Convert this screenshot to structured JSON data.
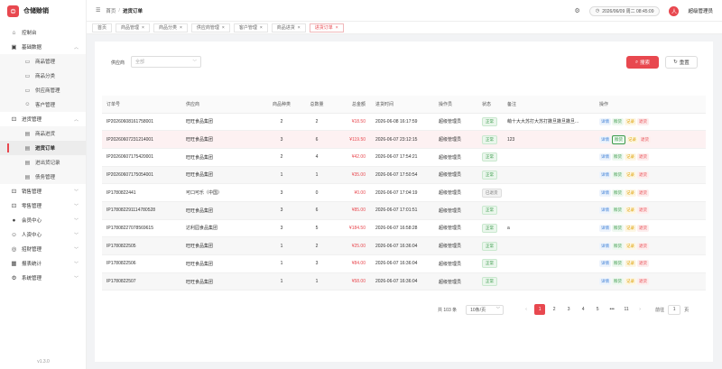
{
  "app": {
    "title": "仓储赊销",
    "logo_glyph": "⊜",
    "version": "v1.3.0",
    "accent": "#e8484f"
  },
  "sidebar": {
    "dashboard": {
      "label": "控制台",
      "icon": "home-icon"
    },
    "basic": {
      "label": "基础数据",
      "icon": "box-icon",
      "children": [
        {
          "label": "商品管理",
          "icon": "folder-icon"
        },
        {
          "label": "商品分类",
          "icon": "folder-icon"
        },
        {
          "label": "供应商管理",
          "icon": "folder-icon"
        },
        {
          "label": "客户管理",
          "icon": "user-icon"
        }
      ]
    },
    "purchase": {
      "label": "进货管理",
      "icon": "cart-icon",
      "children": [
        {
          "label": "商品进货",
          "icon": "doc-icon"
        },
        {
          "label": "进货订单",
          "icon": "doc-icon"
        },
        {
          "label": "进出货记录",
          "icon": "doc-icon"
        },
        {
          "label": "债务管理",
          "icon": "doc-icon"
        }
      ]
    },
    "others": [
      {
        "label": "销售管理",
        "icon": "cart-icon"
      },
      {
        "label": "零售管理",
        "icon": "cart-icon"
      },
      {
        "label": "会员中心",
        "icon": "user-icon"
      },
      {
        "label": "人资中心",
        "icon": "user-icon"
      },
      {
        "label": "招财管理",
        "icon": "coin-icon"
      },
      {
        "label": "报表统计",
        "icon": "chart-icon"
      },
      {
        "label": "系统管理",
        "icon": "gear-icon"
      }
    ]
  },
  "header": {
    "breadcrumb_home": "首页",
    "breadcrumb_sep": "/",
    "breadcrumb_current": "进货订单",
    "datetime": "2026/06/09 周二 08:45:09",
    "user_name": "超级管理员",
    "user_avatar": "人"
  },
  "tabs": [
    {
      "label": "首页"
    },
    {
      "label": "商品管理",
      "close": "×"
    },
    {
      "label": "商品分类",
      "close": "×"
    },
    {
      "label": "供应商管理",
      "close": "×"
    },
    {
      "label": "客户管理",
      "close": "×"
    },
    {
      "label": "商品进货",
      "close": "×"
    },
    {
      "label": "进货订单",
      "close": "×",
      "active": true
    }
  ],
  "filter": {
    "supplier_label": "供应商",
    "supplier_value": "全部",
    "search_label": "搜索",
    "reset_label": "重置"
  },
  "table": {
    "headers": [
      "订单号",
      "供应商",
      "商品种类",
      "总数量",
      "总金额",
      "进货时间",
      "操作员",
      "状态",
      "备注",
      "操作"
    ],
    "rows": [
      {
        "id": "IP20260608161758001",
        "supplier": "旺旺食品集团",
        "kinds": "2",
        "qty": "2",
        "amount": "¥18.50",
        "time": "2026-06-08 16:17:59",
        "operator": "超级管理员",
        "status": "正常",
        "note": "萌十大大苏打大苏打撒旦撒旦撒旦..."
      },
      {
        "id": "IP20260607231214001",
        "supplier": "旺旺食品集团",
        "kinds": "3",
        "qty": "6",
        "amount": "¥119.50",
        "time": "2026-06-07 23:12:15",
        "operator": "超级管理员",
        "status": "正常",
        "note": "123"
      },
      {
        "id": "IP20260607175420001",
        "supplier": "旺旺食品集团",
        "kinds": "2",
        "qty": "4",
        "amount": "¥42.00",
        "time": "2026-06-07 17:54:21",
        "operator": "超级管理员",
        "status": "正常",
        "note": ""
      },
      {
        "id": "IP20260607175054001",
        "supplier": "旺旺食品集团",
        "kinds": "1",
        "qty": "1",
        "amount": "¥35.00",
        "time": "2026-06-07 17:50:54",
        "operator": "超级管理员",
        "status": "正常",
        "note": ""
      },
      {
        "id": "IP1780822441",
        "supplier": "可口可乐（中国）",
        "kinds": "3",
        "qty": "0",
        "amount": "¥0.00",
        "time": "2026-06-07 17:04:19",
        "operator": "超级管理员",
        "status": "已退货",
        "note": ""
      },
      {
        "id": "IP1780822911147805​28",
        "supplier": "旺旺食品集团",
        "kinds": "3",
        "qty": "6",
        "amount": "¥85.00",
        "time": "2026-06-07 17:01:51",
        "operator": "超级管理员",
        "status": "正常",
        "note": ""
      },
      {
        "id": "IP17808227078569615",
        "supplier": "达利园食品集团",
        "kinds": "3",
        "qty": "5",
        "amount": "¥184.50",
        "time": "2026-06-07 16:58:28",
        "operator": "超级管理员",
        "status": "正常",
        "note": "a"
      },
      {
        "id": "IP1780822505",
        "supplier": "旺旺食品集团",
        "kinds": "1",
        "qty": "2",
        "amount": "¥25.00",
        "time": "2026-06-07 16:36:04",
        "operator": "超级管理员",
        "status": "正常",
        "note": ""
      },
      {
        "id": "IP1780822506",
        "supplier": "旺旺食品集团",
        "kinds": "1",
        "qty": "3",
        "amount": "¥84.00",
        "time": "2026-06-07 16:36:04",
        "operator": "超级管理员",
        "status": "正常",
        "note": ""
      },
      {
        "id": "IP1780822507",
        "supplier": "旺旺食品集团",
        "kinds": "1",
        "qty": "1",
        "amount": "¥58.00",
        "time": "2026-06-07 16:36:04",
        "operator": "超级管理员",
        "status": "正常",
        "note": ""
      }
    ],
    "ops": {
      "detail": "详情",
      "pay": "赊货",
      "record": "记录",
      "ret": "退货"
    }
  },
  "pagination": {
    "total": "共 103 条",
    "page_size": "10条/页",
    "prev": "‹",
    "pages": [
      "1",
      "2",
      "3",
      "4",
      "5",
      "•••",
      "11"
    ],
    "current": "1",
    "next": "›",
    "goto_label": "前往",
    "goto_value": "1",
    "goto_suffix": "页"
  }
}
